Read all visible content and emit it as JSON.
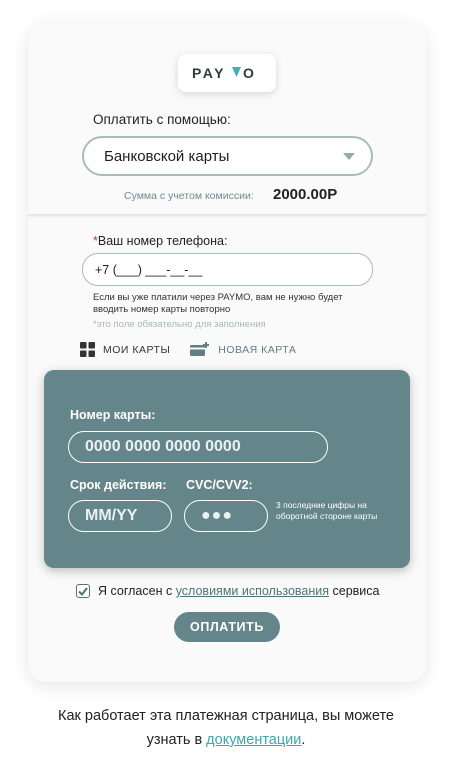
{
  "brand": {
    "logo_text": "PAYMO",
    "accent": "#64858a"
  },
  "payment_method": {
    "label": "Оплатить с помощью:",
    "selected": "Банковской карты"
  },
  "amount": {
    "label": "Сумма с учетом комиссии:",
    "value": "2000.00Р"
  },
  "phone": {
    "required_mark": "*",
    "label": "Ваш номер телефона:",
    "value": "+7 (___) ___-__-__",
    "hint": "Если вы уже платили через PAYMO, вам не нужно будет вводить номер карты повторно",
    "required_note": "*это поле обязательно для заполнения"
  },
  "tabs": {
    "my_cards": {
      "label": "МОИ КАРТЫ",
      "icon": "grid-icon"
    },
    "new_card": {
      "label": "НОВАЯ КАРТА",
      "icon": "add-card-icon"
    }
  },
  "card_form": {
    "number_label": "Номер карты:",
    "number_placeholder": "0000 0000 0000 0000",
    "expiry_label": "Срок действия:",
    "expiry_placeholder": "ММ/YY",
    "cvc_label": "CVC/CVV2:",
    "cvc_placeholder": "●●●",
    "cvc_hint": "3 последние цифры на оборотной стороне карты"
  },
  "agreement": {
    "checked": true,
    "prefix": "Я согласен с ",
    "link": "условиями использования",
    "suffix": " сервиса"
  },
  "pay_button": "ОПЛАТИТЬ",
  "footer": {
    "text": "Как работает эта платежная страница, вы можете узнать в ",
    "link": "документации",
    "end": "."
  }
}
